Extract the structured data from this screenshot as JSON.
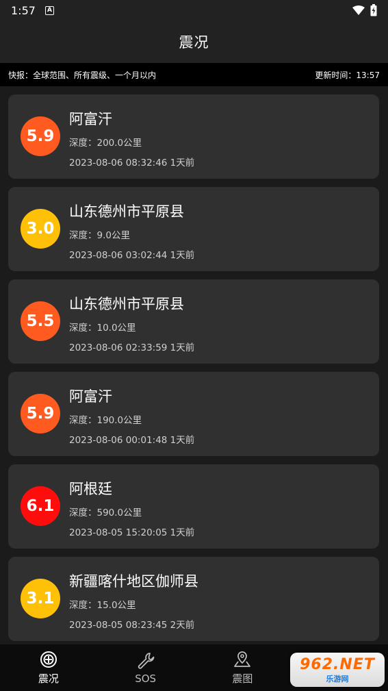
{
  "status_bar": {
    "time": "1:57",
    "a_badge": "A"
  },
  "app_bar": {
    "title": "震况"
  },
  "info_bar": {
    "scope": "快报：全球范围、所有震级、一个月以内",
    "updated": "更新时间：13:57"
  },
  "quakes": [
    {
      "magnitude": "5.9",
      "place": "阿富汗",
      "depth": "深度：200.0公里",
      "time": "2023-08-06 08:32:46 1天前",
      "color": "#ff5a1f"
    },
    {
      "magnitude": "3.0",
      "place": "山东德州市平原县",
      "depth": "深度：9.0公里",
      "time": "2023-08-06 03:02:44 1天前",
      "color": "#ffc107"
    },
    {
      "magnitude": "5.5",
      "place": "山东德州市平原县",
      "depth": "深度：10.0公里",
      "time": "2023-08-06 02:33:59 1天前",
      "color": "#ff5a1f"
    },
    {
      "magnitude": "5.9",
      "place": "阿富汗",
      "depth": "深度：190.0公里",
      "time": "2023-08-06 00:01:48 1天前",
      "color": "#ff5a1f"
    },
    {
      "magnitude": "6.1",
      "place": "阿根廷",
      "depth": "深度：590.0公里",
      "time": "2023-08-05 15:20:05 1天前",
      "color": "#ff0d0d"
    },
    {
      "magnitude": "3.1",
      "place": "新疆喀什地区伽师县",
      "depth": "深度：15.0公里",
      "time": "2023-08-05 08:23:45 2天前",
      "color": "#ffc107"
    }
  ],
  "nav": [
    {
      "label": "震况",
      "icon": "crosshair-icon"
    },
    {
      "label": "SOS",
      "icon": "wrench-icon"
    },
    {
      "label": "震图",
      "icon": "map-pin-icon"
    },
    {
      "label": "",
      "icon": "user-icon"
    }
  ],
  "watermark": {
    "logo": "962.NET",
    "sub": "乐游网"
  }
}
